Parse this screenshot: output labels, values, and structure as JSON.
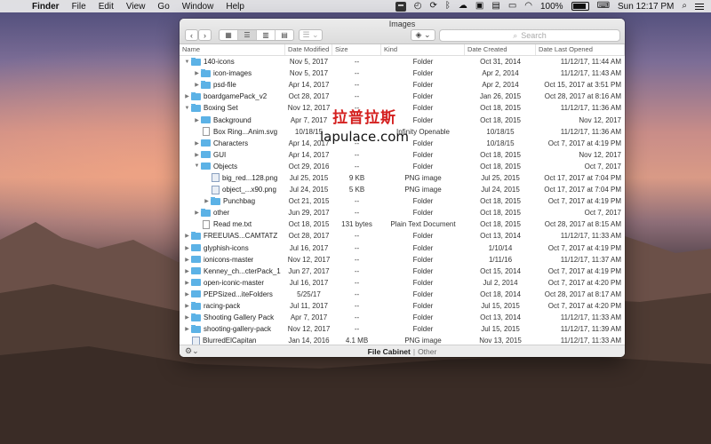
{
  "menubar": {
    "apple": "",
    "items": [
      "Finder",
      "File",
      "Edit",
      "View",
      "Go",
      "Window",
      "Help"
    ],
    "battery_pct": "100%",
    "clock": "Sun 12:17 PM"
  },
  "window": {
    "title": "Images",
    "search_placeholder": "Search",
    "columns": [
      "Name",
      "Date Modified",
      "Size",
      "Kind",
      "Date Created",
      "Date Last Opened"
    ],
    "rows": [
      {
        "name": "140-icons",
        "depth": 0,
        "type": "folder",
        "open": true,
        "modified": "Nov 5, 2017",
        "size": "--",
        "kind": "Folder",
        "created": "Oct 31, 2014",
        "opened": "11/12/17, 11:44 AM"
      },
      {
        "name": "icon-images",
        "depth": 1,
        "type": "folder",
        "open": false,
        "modified": "Nov 5, 2017",
        "size": "--",
        "kind": "Folder",
        "created": "Apr 2, 2014",
        "opened": "11/12/17, 11:43 AM"
      },
      {
        "name": "psd-file",
        "depth": 1,
        "type": "folder",
        "open": false,
        "modified": "Apr 14, 2017",
        "size": "--",
        "kind": "Folder",
        "created": "Apr 2, 2014",
        "opened": "Oct 15, 2017 at 3:51 PM"
      },
      {
        "name": "boardgamePack_v2",
        "depth": 0,
        "type": "folder",
        "open": false,
        "modified": "Oct 28, 2017",
        "size": "--",
        "kind": "Folder",
        "created": "Jan 26, 2015",
        "opened": "Oct 28, 2017 at 8:16 AM"
      },
      {
        "name": "Boxing Set",
        "depth": 0,
        "type": "folder",
        "open": true,
        "modified": "Nov 12, 2017",
        "size": "--",
        "kind": "Folder",
        "created": "Oct 18, 2015",
        "opened": "11/12/17, 11:36 AM"
      },
      {
        "name": "Background",
        "depth": 1,
        "type": "folder",
        "open": false,
        "modified": "Apr 7, 2017",
        "size": "--",
        "kind": "Folder",
        "created": "Oct 18, 2015",
        "opened": "Nov 12, 2017"
      },
      {
        "name": "Box Ring...Anim.svg",
        "depth": 1,
        "type": "file",
        "open": false,
        "modified": "10/18/15",
        "size": "",
        "kind": "Infinity Openable",
        "created": "10/18/15",
        "opened": "11/12/17, 11:36 AM"
      },
      {
        "name": "Characters",
        "depth": 1,
        "type": "folder",
        "open": false,
        "modified": "Apr 14, 2017",
        "size": "--",
        "kind": "Folder",
        "created": "10/18/15",
        "opened": "Oct 7, 2017 at 4:19 PM"
      },
      {
        "name": "GUI",
        "depth": 1,
        "type": "folder",
        "open": false,
        "modified": "Apr 14, 2017",
        "size": "--",
        "kind": "Folder",
        "created": "Oct 18, 2015",
        "opened": "Nov 12, 2017"
      },
      {
        "name": "Objects",
        "depth": 1,
        "type": "folder",
        "open": true,
        "modified": "Oct 29, 2016",
        "size": "--",
        "kind": "Folder",
        "created": "Oct 18, 2015",
        "opened": "Oct 7, 2017"
      },
      {
        "name": "big_red...128.png",
        "depth": 2,
        "type": "image",
        "open": false,
        "modified": "Jul 25, 2015",
        "size": "9 KB",
        "kind": "PNG image",
        "created": "Jul 25, 2015",
        "opened": "Oct 17, 2017 at 7:04 PM"
      },
      {
        "name": "object_...x90.png",
        "depth": 2,
        "type": "image",
        "open": false,
        "modified": "Jul 24, 2015",
        "size": "5 KB",
        "kind": "PNG image",
        "created": "Jul 24, 2015",
        "opened": "Oct 17, 2017 at 7:04 PM"
      },
      {
        "name": "Punchbag",
        "depth": 2,
        "type": "folder",
        "open": false,
        "modified": "Oct 21, 2015",
        "size": "--",
        "kind": "Folder",
        "created": "Oct 18, 2015",
        "opened": "Oct 7, 2017 at 4:19 PM"
      },
      {
        "name": "other",
        "depth": 1,
        "type": "folder",
        "open": false,
        "modified": "Jun 29, 2017",
        "size": "--",
        "kind": "Folder",
        "created": "Oct 18, 2015",
        "opened": "Oct 7, 2017"
      },
      {
        "name": "Read me.txt",
        "depth": 1,
        "type": "file",
        "open": false,
        "modified": "Oct 18, 2015",
        "size": "131 bytes",
        "kind": "Plain Text Document",
        "created": "Oct 18, 2015",
        "opened": "Oct 28, 2017 at 8:15 AM"
      },
      {
        "name": "FREEUIAS...CAMTATZ",
        "depth": 0,
        "type": "folder",
        "open": false,
        "modified": "Oct 28, 2017",
        "size": "--",
        "kind": "Folder",
        "created": "Oct 13, 2014",
        "opened": "11/12/17, 11:33 AM"
      },
      {
        "name": "glyphish-icons",
        "depth": 0,
        "type": "folder",
        "open": false,
        "modified": "Jul 16, 2017",
        "size": "--",
        "kind": "Folder",
        "created": "1/10/14",
        "opened": "Oct 7, 2017 at 4:19 PM"
      },
      {
        "name": "ionicons-master",
        "depth": 0,
        "type": "folder",
        "open": false,
        "modified": "Nov 12, 2017",
        "size": "--",
        "kind": "Folder",
        "created": "1/11/16",
        "opened": "11/12/17, 11:37 AM"
      },
      {
        "name": "Kenney_ch...cterPack_1",
        "depth": 0,
        "type": "folder",
        "open": false,
        "modified": "Jun 27, 2017",
        "size": "--",
        "kind": "Folder",
        "created": "Oct 15, 2014",
        "opened": "Oct 7, 2017 at 4:19 PM"
      },
      {
        "name": "open-iconic-master",
        "depth": 0,
        "type": "folder",
        "open": false,
        "modified": "Jul 16, 2017",
        "size": "--",
        "kind": "Folder",
        "created": "Jul 2, 2014",
        "opened": "Oct 7, 2017 at 4:20 PM"
      },
      {
        "name": "PEPSized...iteFolders",
        "depth": 0,
        "type": "folder",
        "open": false,
        "modified": "5/25/17",
        "size": "--",
        "kind": "Folder",
        "created": "Oct 18, 2014",
        "opened": "Oct 28, 2017 at 8:17 AM"
      },
      {
        "name": "racing-pack",
        "depth": 0,
        "type": "folder",
        "open": false,
        "modified": "Jul 11, 2017",
        "size": "--",
        "kind": "Folder",
        "created": "Jul 15, 2015",
        "opened": "Oct 7, 2017 at 4:20 PM"
      },
      {
        "name": "Shooting Gallery Pack",
        "depth": 0,
        "type": "folder",
        "open": false,
        "modified": "Apr 7, 2017",
        "size": "--",
        "kind": "Folder",
        "created": "Oct 13, 2014",
        "opened": "11/12/17, 11:33 AM"
      },
      {
        "name": "shooting-gallery-pack",
        "depth": 0,
        "type": "folder",
        "open": false,
        "modified": "Nov 12, 2017",
        "size": "--",
        "kind": "Folder",
        "created": "Jul 15, 2015",
        "opened": "11/12/17, 11:39 AM"
      },
      {
        "name": "BlurredElCapitan",
        "depth": 0,
        "type": "image",
        "open": false,
        "modified": "Jan 14, 2016",
        "size": "4.1 MB",
        "kind": "PNG image",
        "created": "Nov 13, 2015",
        "opened": "11/12/17, 11:33 AM"
      }
    ],
    "footer_primary": "File Cabinet",
    "footer_secondary": "Other"
  },
  "watermark": {
    "chinese": "拉普拉斯",
    "url": "lapulace.com"
  }
}
